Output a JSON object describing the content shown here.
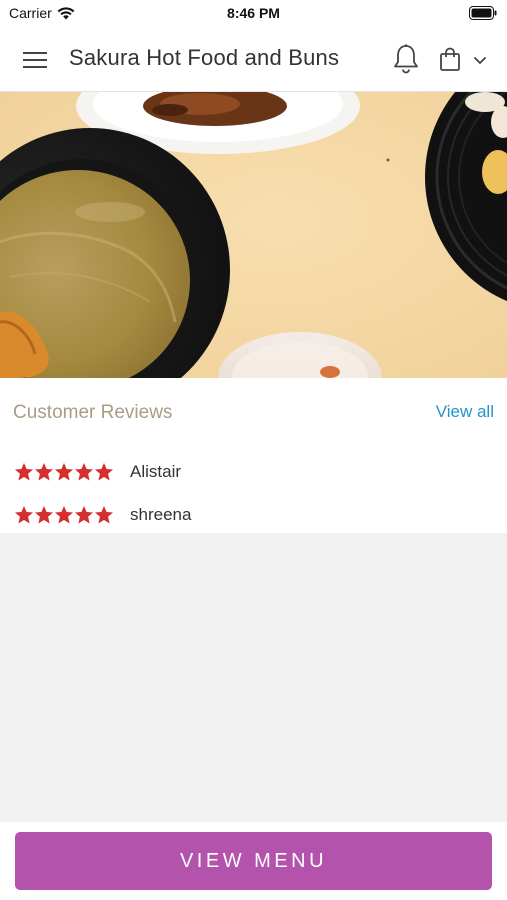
{
  "status_bar": {
    "carrier": "Carrier",
    "time": "8:46 PM"
  },
  "header": {
    "title": "Sakura Hot Food and Buns",
    "icons": [
      "menu-icon",
      "bell-icon",
      "shopping-bag-icon",
      "chevron-down-icon"
    ]
  },
  "hero": {
    "image": "food-photo"
  },
  "reviews": {
    "title": "Customer Reviews",
    "view_all": "View all",
    "items": [
      {
        "name": "Alistair",
        "rating": 5
      },
      {
        "name": "shreena",
        "rating": 5
      }
    ]
  },
  "footer": {
    "view_menu": "VIEW MENU"
  },
  "colors": {
    "accent": "#b353ab",
    "link": "#2196c8",
    "star": "#d32f2f",
    "section_title": "#a89d84",
    "page_bg": "#f1f1f1"
  }
}
